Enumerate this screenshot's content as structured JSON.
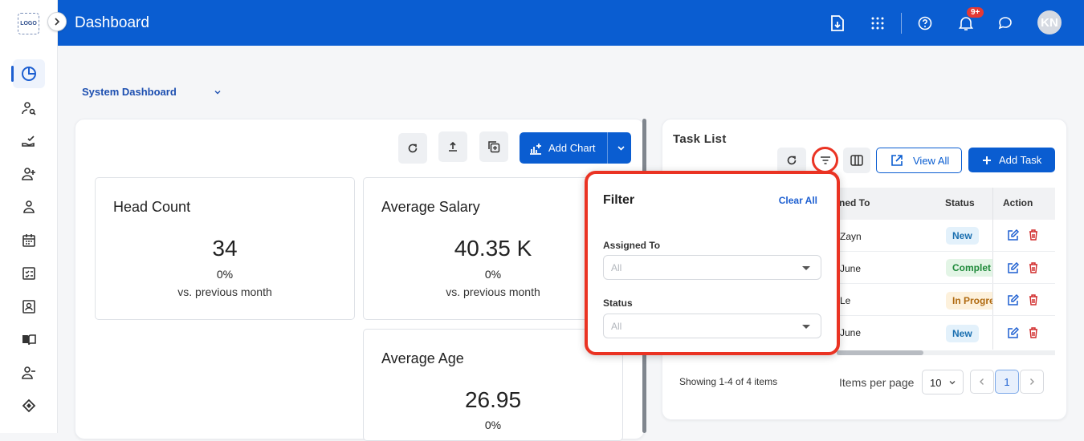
{
  "logo": {
    "text": "LOGO"
  },
  "header": {
    "title": "Dashboard",
    "notification_badge": "9+",
    "avatar_initials": "KN"
  },
  "dashboard_selector": {
    "value": "System Dashboard"
  },
  "toolbar": {
    "add_chart_label": "Add Chart"
  },
  "stats": [
    {
      "label": "Head Count",
      "value": "34",
      "change": "0%",
      "comparison": "vs. previous month"
    },
    {
      "label": "Average Salary",
      "value": "40.35 K",
      "change": "0%",
      "comparison": "vs. previous month"
    },
    {
      "label": "Average Age",
      "value": "26.95",
      "change": "0%"
    }
  ],
  "task_list": {
    "title": "Task List",
    "view_all_label": "View All",
    "add_task_label": "Add Task",
    "columns": [
      "ned To",
      "Status",
      "Action"
    ],
    "rows": [
      {
        "assigned": "Zayn",
        "status": "New",
        "status_color": "#e3f1fb",
        "status_text_color": "#1a6fb0"
      },
      {
        "assigned": "June",
        "status": "Complet",
        "status_color": "#e3f5e6",
        "status_text_color": "#1f8a3a"
      },
      {
        "assigned": "Le",
        "status": "In Progre",
        "status_color": "#fdf1dc",
        "status_text_color": "#b06a10"
      },
      {
        "assigned": "June",
        "status": "New",
        "status_color": "#e3f1fb",
        "status_text_color": "#1a6fb0"
      }
    ],
    "showing": "Showing 1-4 of 4 items",
    "items_per_page_label": "Items per page",
    "items_per_page_value": "10",
    "current_page": "1"
  },
  "filter": {
    "title": "Filter",
    "clear_label": "Clear All",
    "assigned_label": "Assigned To",
    "assigned_placeholder": "All",
    "status_label": "Status",
    "status_placeholder": "All"
  },
  "colors": {
    "primary": "#0a5dd1",
    "highlight": "#ea3323"
  }
}
